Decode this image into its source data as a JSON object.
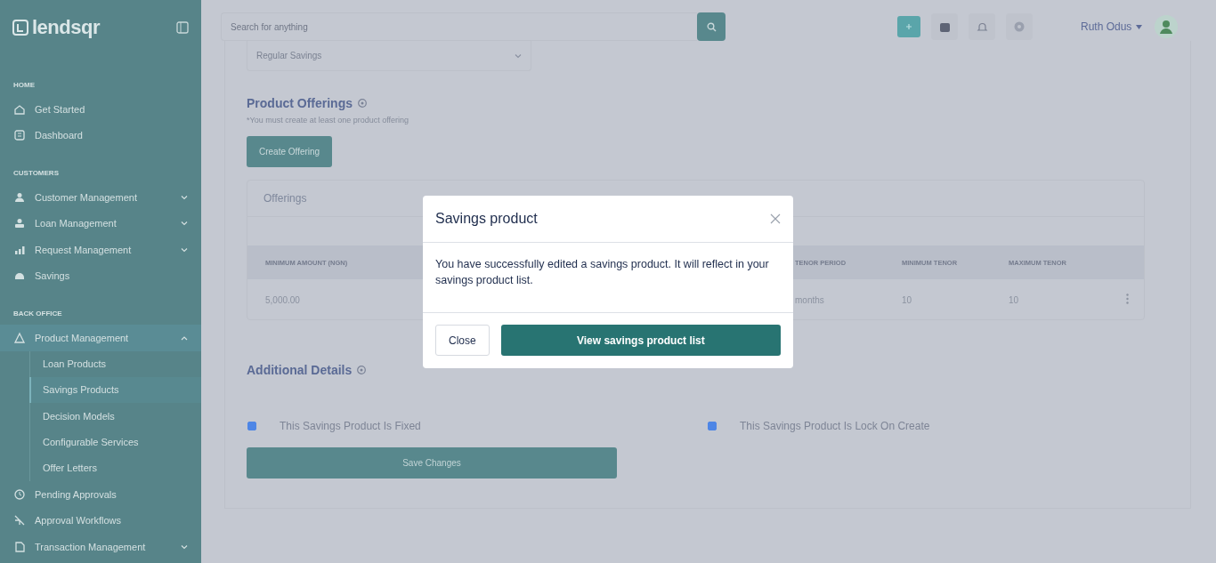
{
  "sidebar": {
    "logo": "lendsqr",
    "sections": [
      {
        "title": "HOME",
        "items": [
          {
            "label": "Get Started",
            "selected": false
          },
          {
            "label": "Dashboard",
            "selected": false
          }
        ]
      },
      {
        "title": "CUSTOMERS",
        "items": [
          {
            "label": "Customer Management",
            "selected": false,
            "expanded": false
          },
          {
            "label": "Loan Management",
            "selected": false,
            "expanded": false
          },
          {
            "label": "Request Management",
            "selected": false,
            "expanded": false
          },
          {
            "label": "Savings",
            "selected": false
          }
        ]
      },
      {
        "title": "BACK OFFICE",
        "items": [
          {
            "label": "Product Management",
            "selected": true,
            "expanded": true,
            "children": [
              {
                "label": "Loan Products",
                "selected": false
              },
              {
                "label": "Savings Products",
                "selected": true
              },
              {
                "label": "Decision Models",
                "selected": false
              },
              {
                "label": "Configurable Services",
                "selected": false
              },
              {
                "label": "Offer Letters",
                "selected": false
              }
            ]
          },
          {
            "label": "Pending Approvals",
            "selected": false
          },
          {
            "label": "Approval Workflows",
            "selected": false
          },
          {
            "label": "Transaction Management",
            "selected": false,
            "expanded": false
          }
        ]
      }
    ]
  },
  "header": {
    "search": {
      "placeholder": "Search for anything"
    },
    "user": {
      "name": "Ruth Odus"
    }
  },
  "form": {
    "product_type": {
      "value": "Regular Savings"
    },
    "offerings": {
      "title": "Product Offerings",
      "note": "*You must create at least one product offering",
      "create_button": "Create Offering",
      "table_title": "Offerings",
      "columns": [
        {
          "label": "MINIMUM AMOUNT (NGN)"
        },
        {
          "label": "TENOR PERIOD"
        },
        {
          "label": "MINIMUM TENOR"
        },
        {
          "label": "MAXIMUM TENOR"
        }
      ],
      "rows": [
        {
          "cells": [
            "5,000.00",
            "months",
            "10",
            "10"
          ]
        }
      ]
    },
    "additional": {
      "title": "Additional Details",
      "options": [
        {
          "label": "This Savings Product Is Fixed",
          "checked": true
        },
        {
          "label": "This Savings Product Is Lock On Create",
          "checked": true
        }
      ]
    },
    "save_button": "Save Changes"
  },
  "modal": {
    "title": "Savings product",
    "message": "You have successfully edited a savings product. It will reflect in your savings product list.",
    "buttons": [
      {
        "label": "Close",
        "kind": "secondary"
      },
      {
        "label": "View savings product list",
        "kind": "primary"
      }
    ]
  }
}
